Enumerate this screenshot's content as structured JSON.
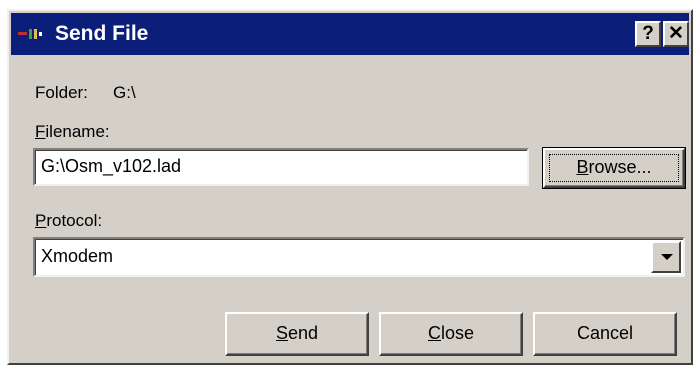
{
  "window": {
    "title": "Send File",
    "help_glyph": "?",
    "close_glyph": "✕",
    "title_bar_color": "#0a1e7a",
    "icon": "app-icon"
  },
  "folder": {
    "label": "Folder:",
    "value": "G:\\"
  },
  "filename": {
    "label_mnemonic": "F",
    "label_rest": "ilename:",
    "value": "G:\\Osm_v102.lad"
  },
  "browse": {
    "label_mnemonic": "B",
    "label_rest": "rowse..."
  },
  "protocol": {
    "label_mnemonic": "P",
    "label_rest": "rotocol:",
    "selected": "Xmodem"
  },
  "buttons": {
    "send_mnemonic": "S",
    "send_rest": "end",
    "close_mnemonic": "C",
    "close_rest": "lose",
    "cancel": "Cancel"
  }
}
